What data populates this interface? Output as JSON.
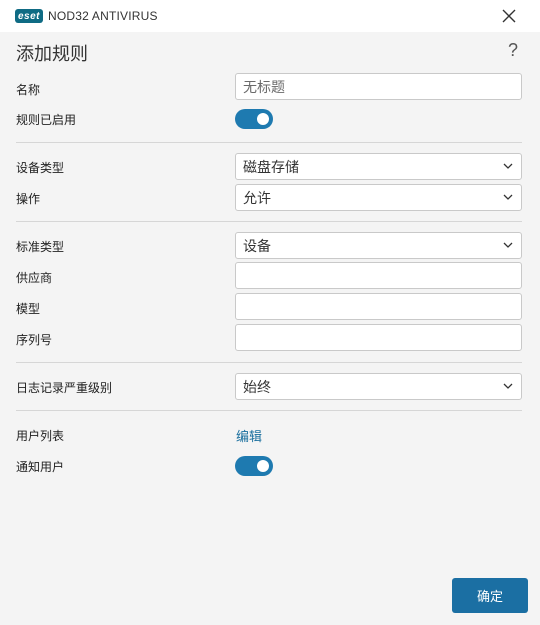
{
  "app": {
    "logo_text": "eset",
    "product_name": "NOD32 ANTIVIRUS",
    "accent": "#1b6fa3",
    "close_icon": "close-icon"
  },
  "dialog": {
    "title": "添加规则",
    "help_label": "?"
  },
  "form": {
    "name": {
      "label": "名称",
      "placeholder": "无标题"
    },
    "rule_enabled": {
      "label": "规则已启用",
      "state": "on"
    },
    "device_type": {
      "label": "设备类型",
      "value": "磁盘存储"
    },
    "action": {
      "label": "操作",
      "value": "允许"
    },
    "criteria_type": {
      "label": "标准类型",
      "value": "设备"
    },
    "vendor": {
      "label": "供应商",
      "value": ""
    },
    "model": {
      "label": "模型",
      "value": ""
    },
    "serial": {
      "label": "序列号",
      "value": ""
    },
    "log_severity": {
      "label": "日志记录严重级别",
      "value": "始终"
    },
    "user_list": {
      "label": "用户列表",
      "link": "编辑"
    },
    "notify_user": {
      "label": "通知用户",
      "state": "on"
    }
  },
  "footer": {
    "ok_label": "确定"
  }
}
